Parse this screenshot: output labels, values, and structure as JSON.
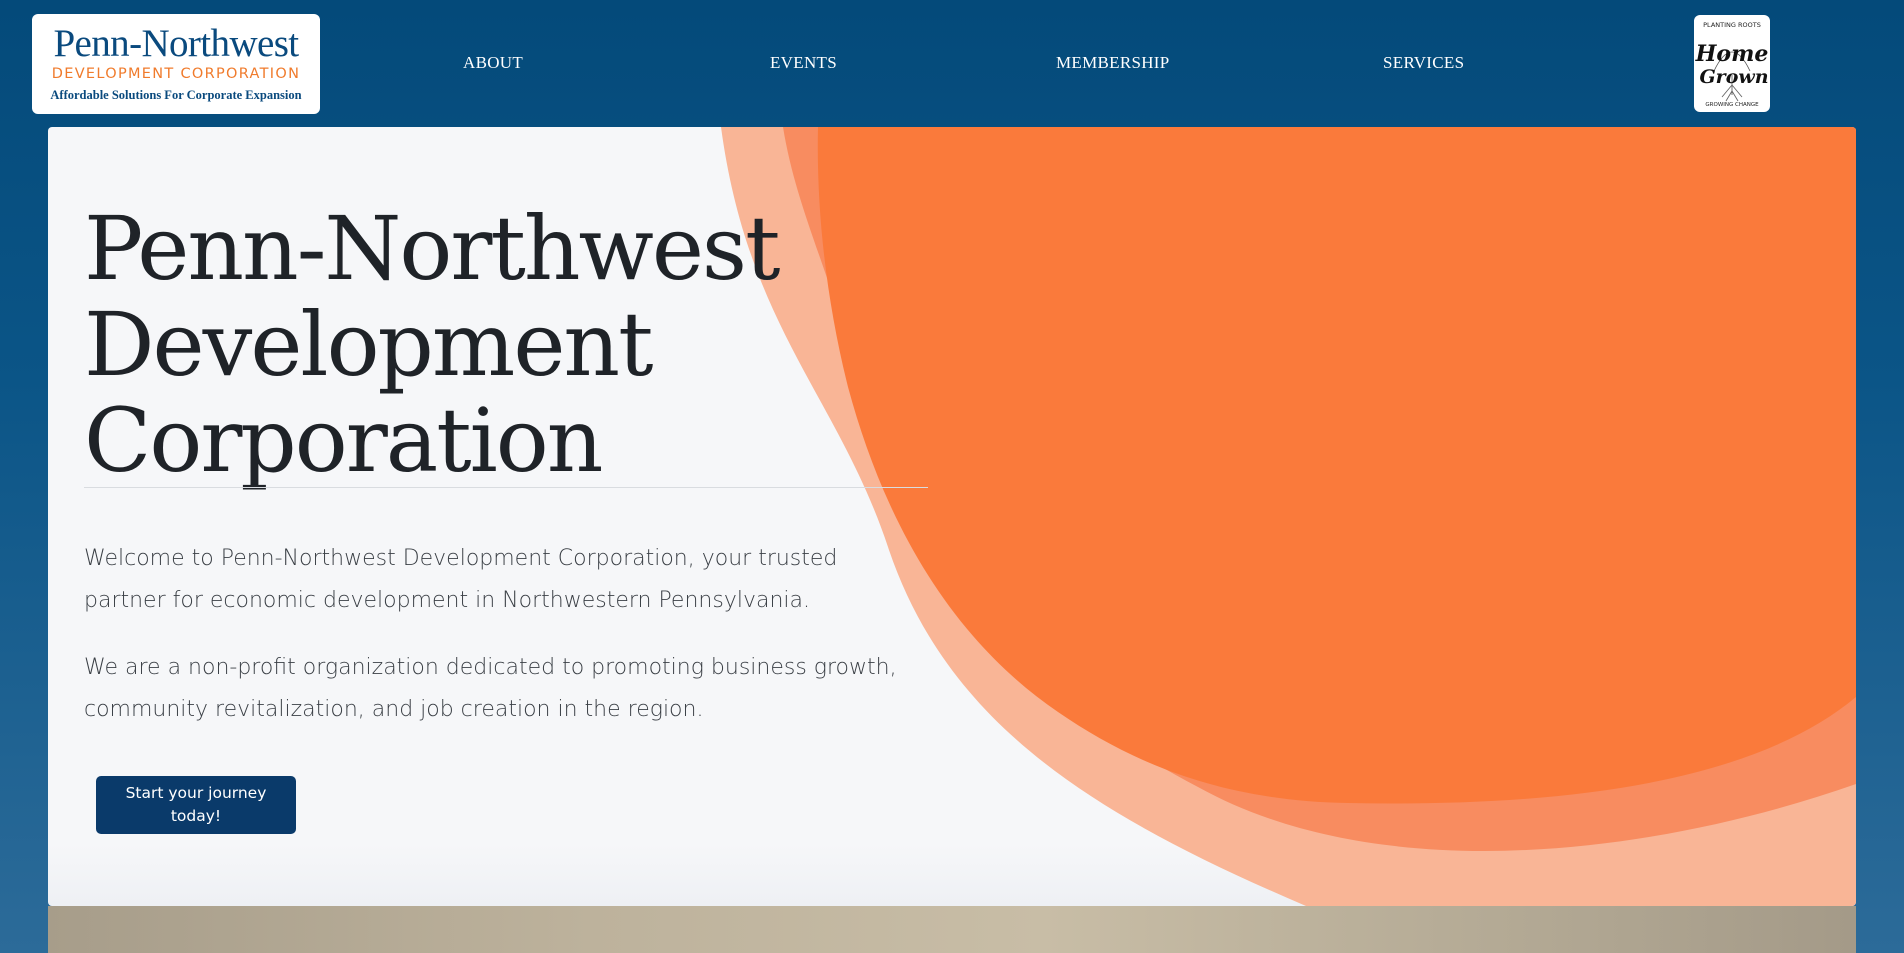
{
  "header": {
    "logo": {
      "title": "Penn-Northwest",
      "subtitle": "DEVELOPMENT CORPORATION",
      "tagline": "Affordable Solutions For Corporate Expansion"
    },
    "nav": [
      {
        "label": "ABOUT"
      },
      {
        "label": "EVENTS"
      },
      {
        "label": "MEMBERSHIP"
      },
      {
        "label": "SERVICES"
      }
    ],
    "badge": {
      "top_text": "PLANTING ROOTS",
      "line1": "Home",
      "line2": "Grown",
      "bottom_text": "GROWING CHANGE"
    }
  },
  "hero": {
    "title": "Penn-Northwest Development Corporation",
    "paragraph1": "Welcome to Penn-Northwest Development Corporation, your trusted partner for economic development in Northwestern Pennsylvania.",
    "paragraph2": "We are a non-profit organization dedicated to promoting business growth, community revitalization, and job creation in the region.",
    "cta_label": "Start your journey today!"
  },
  "colors": {
    "header_bg": "#044a7a",
    "brand_navy": "#0a4a7e",
    "brand_orange": "#f07b2c",
    "blob_orange": "#fa7a3b",
    "blob_light": "#f9b596",
    "button_bg": "#0a3a6a"
  }
}
